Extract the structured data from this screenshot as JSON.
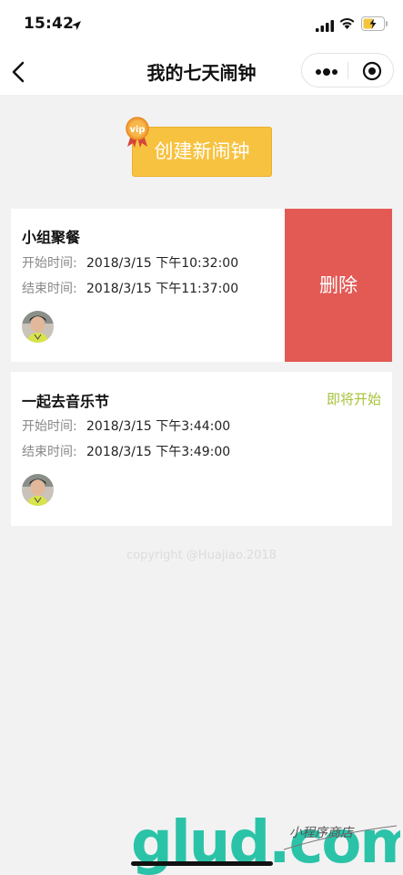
{
  "status_bar": {
    "time": "15:42",
    "icons": [
      "location-arrow-icon",
      "signal-icon",
      "wifi-icon",
      "battery-charging-icon"
    ]
  },
  "nav": {
    "title": "我的七天闹钟",
    "back_icon": "chevron-left-icon",
    "more_icon": "more-dots-icon",
    "close_icon": "target-close-icon"
  },
  "create_button": {
    "label": "创建新闹钟",
    "badge": "vip"
  },
  "alarms": [
    {
      "title": "小组聚餐",
      "start_label": "开始时间:",
      "start_value": "2018/3/15 下午10:32:00",
      "end_label": "结束时间:",
      "end_value": "2018/3/15 下午11:37:00",
      "action_label": "删除"
    },
    {
      "title": "一起去音乐节",
      "status": "即将开始",
      "start_label": "开始时间:",
      "start_value": "2018/3/15 下午3:44:00",
      "end_label": "结束时间:",
      "end_value": "2018/3/15 下午3:49:00"
    }
  ],
  "footer": {
    "copyright": "copyright @Huajiao.2018"
  },
  "watermark": {
    "brand": "glud.com",
    "tagline": "小程序商店"
  },
  "colors": {
    "accent_yellow": "#f7c23f",
    "delete_red": "#e35a55",
    "status_green": "#a5c23a",
    "background": "#f2f2f2"
  }
}
